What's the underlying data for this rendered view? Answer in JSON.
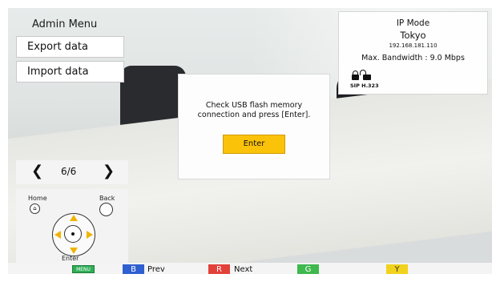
{
  "admin_menu": {
    "title": "Admin Menu",
    "items": [
      {
        "label": "Export data"
      },
      {
        "label": "Import data"
      }
    ]
  },
  "pager": {
    "prev_icon": "chevron-left-icon",
    "next_icon": "chevron-right-icon",
    "text": "6/6"
  },
  "remote": {
    "home_label": "Home",
    "back_label": "Back",
    "enter_label": "Enter"
  },
  "status": {
    "mode": "IP Mode",
    "city": "Tokyo",
    "ip": "192.168.181.110",
    "bandwidth": "Max. Bandwidth : 9.0 Mbps",
    "protocols": "SIP H.323"
  },
  "dialog": {
    "message_line1": "Check USB flash memory",
    "message_line2": "connection and press [Enter].",
    "button": "Enter"
  },
  "bottom_bar": {
    "menu_key": "MENU",
    "b_key": "B",
    "b_label": "Prev",
    "r_key": "R",
    "r_label": "Next",
    "g_key": "G",
    "y_key": "Y"
  },
  "colors": {
    "accent_yellow": "#fbc20a",
    "key_blue": "#2f5fd0",
    "key_red": "#e2413a",
    "key_green": "#3fb84e",
    "key_yellow": "#f1d21d"
  }
}
